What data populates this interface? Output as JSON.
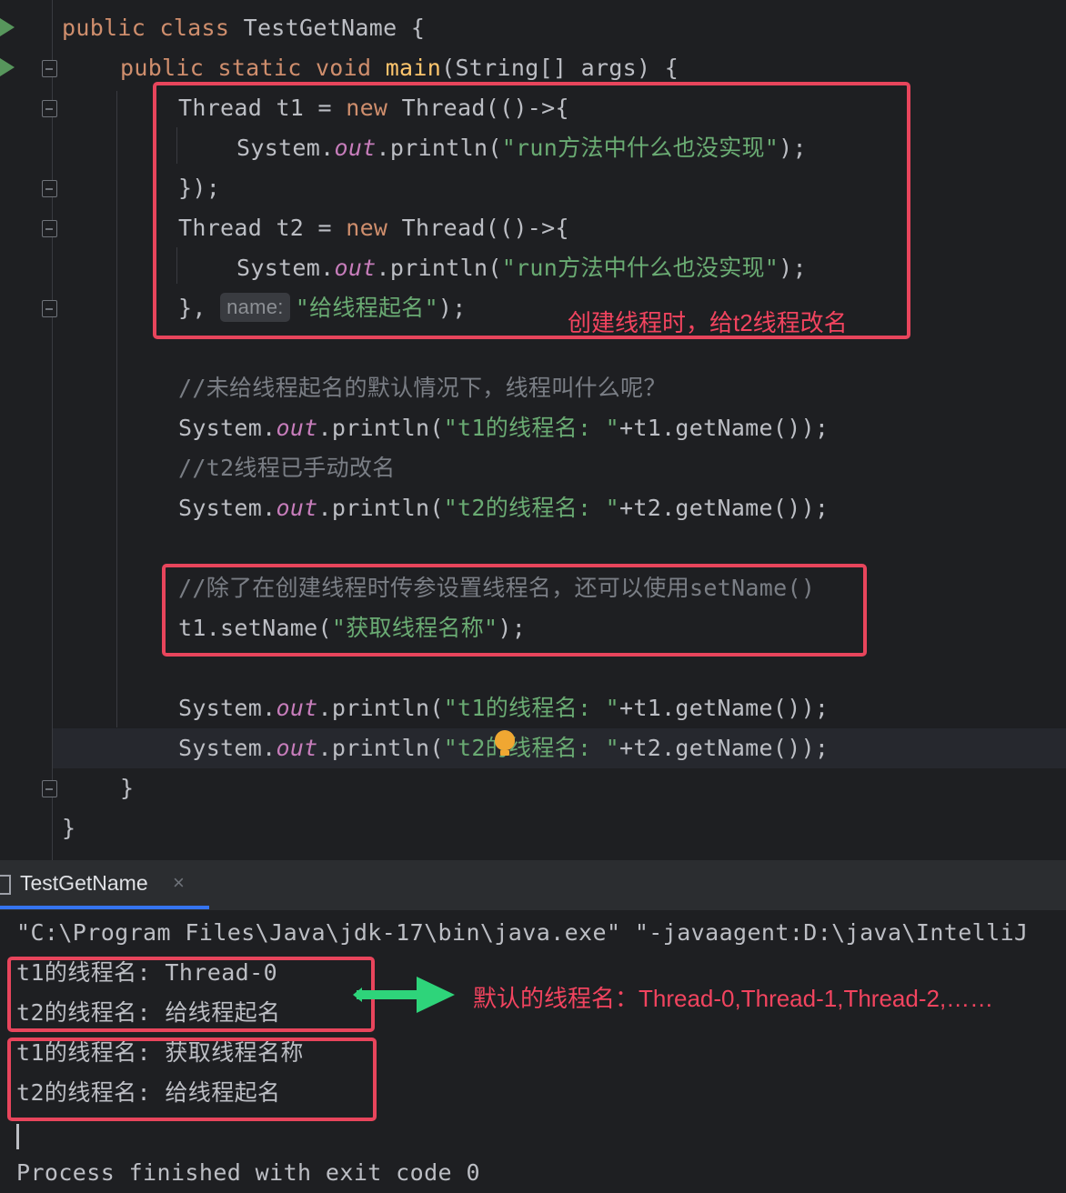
{
  "code": {
    "l1": {
      "kw1": "public",
      "kw2": "class",
      "name": "TestGetName",
      "brace": "{"
    },
    "l2": {
      "kw1": "public",
      "kw2": "static",
      "kw3": "void",
      "method": "main",
      "params": "(String[] args) {"
    },
    "l3": {
      "pre": "Thread t1 = ",
      "kw": "new",
      "post": " Thread(()->{"
    },
    "l4": {
      "pre": "System.",
      "field": "out",
      "mid": ".println(",
      "str": "\"run方法中什么也没实现\"",
      "post": ");"
    },
    "l5": {
      "text": "});"
    },
    "l6": {
      "pre": "Thread t2 = ",
      "kw": "new",
      "post": " Thread(()->{"
    },
    "l7": {
      "pre": "System.",
      "field": "out",
      "mid": ".println(",
      "str": "\"run方法中什么也没实现\"",
      "post": ");"
    },
    "l8": {
      "pre": "},",
      "hint": "name:",
      "str": "\"给线程起名\"",
      "post": ");"
    },
    "l10": {
      "comment": "//未给线程起名的默认情况下，线程叫什么呢？"
    },
    "l11": {
      "pre": "System.",
      "field": "out",
      "mid": ".println(",
      "str": "\"t1的线程名: \"",
      "post": "+t1.getName());"
    },
    "l12": {
      "comment": "//t2线程已手动改名"
    },
    "l13": {
      "pre": "System.",
      "field": "out",
      "mid": ".println(",
      "str": "\"t2的线程名: \"",
      "post": "+t2.getName());"
    },
    "l15": {
      "comment": "//除了在创建线程时传参设置线程名，还可以使用setName()"
    },
    "l16": {
      "pre": "t1.setName(",
      "str": "\"获取线程名称\"",
      "post": ");"
    },
    "l18": {
      "pre": "System.",
      "field": "out",
      "mid": ".println(",
      "str": "\"t1的线程名: \"",
      "post": "+t1.getName());"
    },
    "l19": {
      "pre": "System.",
      "field": "out",
      "mid": ".println(",
      "str": "\"t2的线程名: \"",
      "post": "+t2.getName());"
    },
    "l20": {
      "text": "}"
    },
    "l21": {
      "text": "}"
    }
  },
  "annotations": {
    "thread_creation": "创建线程时，给t2线程改名",
    "default_names": "默认的线程名：Thread-0,Thread-1,Thread-2,……"
  },
  "run_panel": {
    "tab_label": "TestGetName",
    "tab_close": "×",
    "console": [
      "\"C:\\Program Files\\Java\\jdk-17\\bin\\java.exe\" \"-javaagent:D:\\java\\IntelliJ",
      "t1的线程名: Thread-0",
      "t2的线程名: 给线程起名",
      "t1的线程名: 获取线程名称",
      "t2的线程名: 给线程起名",
      "",
      "Process finished with exit code 0"
    ]
  },
  "colors": {
    "annotation_red": "#e8455c",
    "arrow_green": "#2ed47a",
    "keyword": "#cf8e6d",
    "string": "#6aab73",
    "field": "#c77dbb",
    "comment": "#7a7e85"
  },
  "icons": [
    "run-icon",
    "fold-icon",
    "bulb-icon",
    "tab-icon",
    "close-icon",
    "arrow-icon"
  ]
}
